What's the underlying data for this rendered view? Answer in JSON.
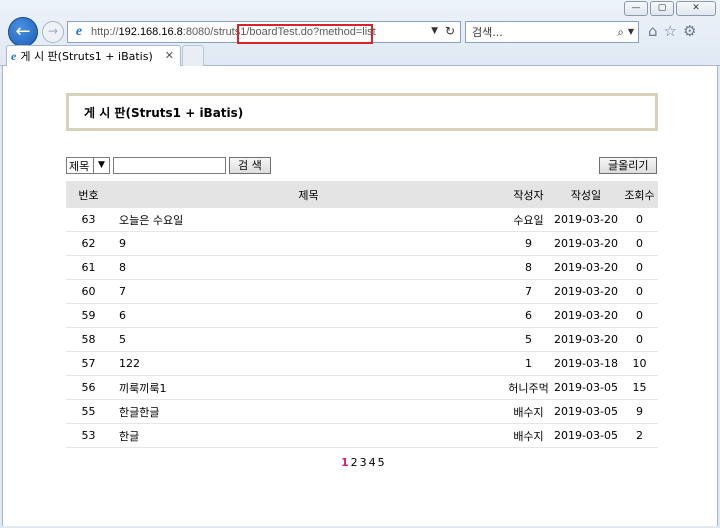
{
  "browser": {
    "url_prefix": "http://",
    "url_host": "192.168.16.8",
    "url_rest": ":8080/struts1/boardTest.do?method=list",
    "search_placeholder": "검색...",
    "tab_title": "게 시 판(Struts1 + iBatis)",
    "window_controls": [
      "—",
      "▢",
      "✕"
    ],
    "icons": [
      "ie-logo-icon",
      "back-arrow-icon",
      "forward-arrow-icon",
      "refresh-icon",
      "search-icon",
      "home-icon",
      "favorites-star-icon",
      "settings-gear-icon"
    ]
  },
  "page": {
    "heading": "게 시 판(Struts1 + iBatis)",
    "search_select_value": "제목",
    "search_button": "검 색",
    "write_button": "글올리기"
  },
  "table": {
    "headers": {
      "no": "번호",
      "title": "제목",
      "writer": "작성자",
      "date": "작성일",
      "views": "조회수"
    },
    "rows": [
      {
        "no": "63",
        "title": "오늘은 수요일",
        "writer": "수요일",
        "date": "2019-03-20",
        "views": "0"
      },
      {
        "no": "62",
        "title": "9",
        "writer": "9",
        "date": "2019-03-20",
        "views": "0"
      },
      {
        "no": "61",
        "title": "8",
        "writer": "8",
        "date": "2019-03-20",
        "views": "0"
      },
      {
        "no": "60",
        "title": "7",
        "writer": "7",
        "date": "2019-03-20",
        "views": "0"
      },
      {
        "no": "59",
        "title": "6",
        "writer": "6",
        "date": "2019-03-20",
        "views": "0"
      },
      {
        "no": "58",
        "title": "5",
        "writer": "5",
        "date": "2019-03-20",
        "views": "0"
      },
      {
        "no": "57",
        "title": "122",
        "writer": "1",
        "date": "2019-03-18",
        "views": "10"
      },
      {
        "no": "56",
        "title": "끼룩끼룩1",
        "writer": "허니주먹",
        "date": "2019-03-05",
        "views": "15"
      },
      {
        "no": "55",
        "title": "한글한글",
        "writer": "배수지",
        "date": "2019-03-05",
        "views": "9"
      },
      {
        "no": "53",
        "title": "한글",
        "writer": "배수지",
        "date": "2019-03-05",
        "views": "2"
      }
    ]
  },
  "pagination": {
    "current": "1",
    "pages": [
      "1",
      "2",
      "3",
      "4",
      "5"
    ]
  },
  "colors": {
    "url_highlight": "#d8232a",
    "current_page": "#d01b8a",
    "title_box_border": "#d8d2bd",
    "header_bg": "#e4e4e4"
  }
}
